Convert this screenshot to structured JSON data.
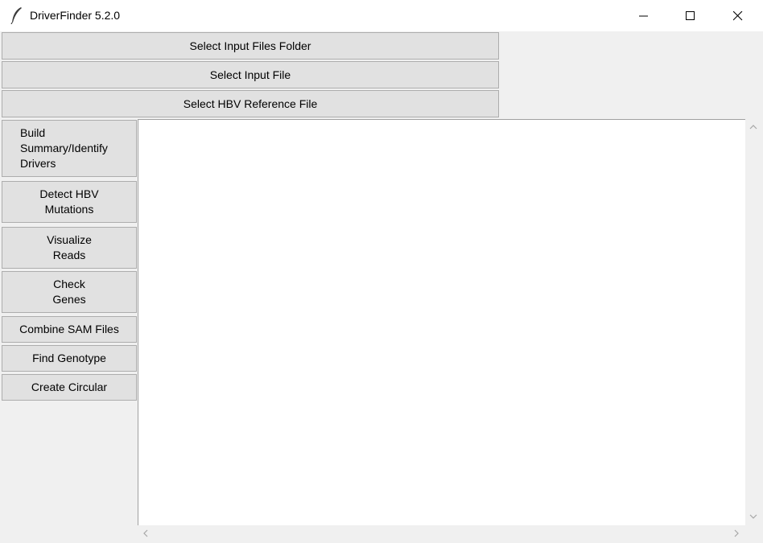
{
  "window": {
    "title": "DriverFinder 5.2.0",
    "icon": "feather-icon",
    "controls": [
      "minimize-icon",
      "maximize-icon",
      "close-icon"
    ]
  },
  "top_buttons": [
    {
      "label": "Select Input Files Folder"
    },
    {
      "label": "Select Input File"
    },
    {
      "label": "Select HBV Reference File"
    }
  ],
  "side_buttons": [
    {
      "label": "Build\nSummary/Identify\nDrivers"
    },
    {
      "label": "Detect HBV\nMutations"
    },
    {
      "label": "Visualize\nReads"
    },
    {
      "label": "Check\nGenes"
    },
    {
      "label": "Combine SAM Files"
    },
    {
      "label": "Find Genotype"
    },
    {
      "label": "Create Circular"
    }
  ],
  "output": {
    "text": ""
  }
}
